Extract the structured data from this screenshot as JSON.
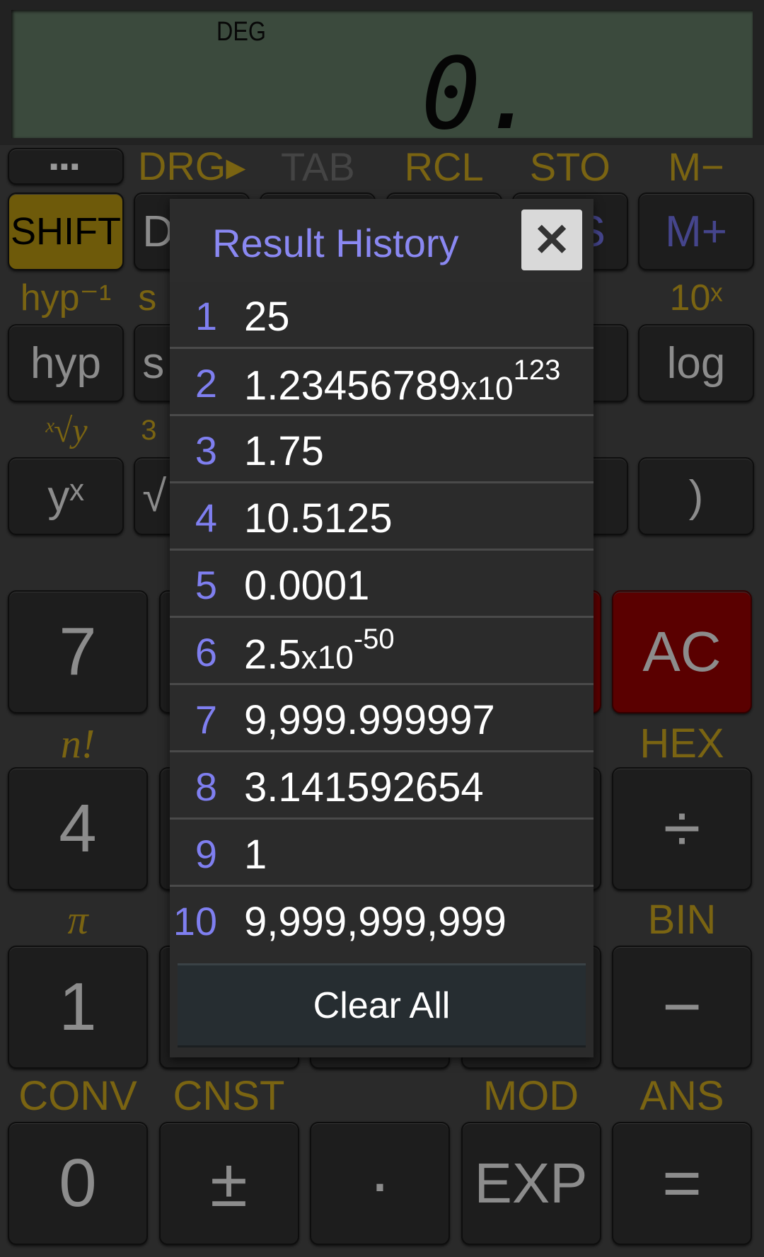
{
  "display": {
    "mode": "DEG",
    "value": "0."
  },
  "colors": {
    "accent_label": "#7a6412",
    "shift_key": "#6e5a0a",
    "clear_key": "#5a0000",
    "memory_key_text": "#45458c",
    "history_index": "#7f7ff0",
    "history_title": "#8a88f2",
    "lcd_background": "#3b4a3d"
  },
  "keypad": {
    "menu_key": {
      "label": "...",
      "icon": "more-dots-icon"
    },
    "top_labels": [
      "DRG▸",
      "TAB",
      "RCL",
      "STO",
      "M−"
    ],
    "row1": [
      "SHIFT",
      "D",
      "",
      "",
      "S",
      "M+"
    ],
    "row1_labels": [
      "hyp⁻¹",
      "s",
      "10ˣ"
    ],
    "row2": [
      "hyp",
      "s",
      "",
      "",
      "",
      "log"
    ],
    "row2_labels": [
      "ˣ√y",
      "3"
    ],
    "row3": [
      "yˣ",
      "√",
      "",
      "",
      "",
      ")"
    ],
    "row4": [
      "7",
      "",
      "",
      "",
      "AC"
    ],
    "row4_labels": [
      "n!",
      "HEX"
    ],
    "row5": [
      "4",
      "",
      "",
      "",
      "÷"
    ],
    "row5_labels": [
      "π",
      "BIN"
    ],
    "row6": [
      "1",
      "",
      "",
      "",
      "−"
    ],
    "row6_labels": [
      "CONV",
      "CNST",
      "",
      "MOD",
      "ANS"
    ],
    "row7": [
      "0",
      "±",
      "·",
      "EXP",
      "="
    ]
  },
  "history_dialog": {
    "title": "Result History",
    "close_icon": "close-x-icon",
    "items": [
      {
        "index": "1",
        "value": "25"
      },
      {
        "index": "2",
        "value": "1.23456789",
        "base": "x10",
        "exponent": "123"
      },
      {
        "index": "3",
        "value": "1.75"
      },
      {
        "index": "4",
        "value": "10.5125"
      },
      {
        "index": "5",
        "value": "0.0001"
      },
      {
        "index": "6",
        "value": "2.5",
        "base": "x10",
        "exponent": "-50"
      },
      {
        "index": "7",
        "value": "9,999.999997"
      },
      {
        "index": "8",
        "value": "3.141592654"
      },
      {
        "index": "9",
        "value": "1"
      },
      {
        "index": "10",
        "value": "9,999,999,999"
      }
    ],
    "clear_all_label": "Clear All"
  }
}
